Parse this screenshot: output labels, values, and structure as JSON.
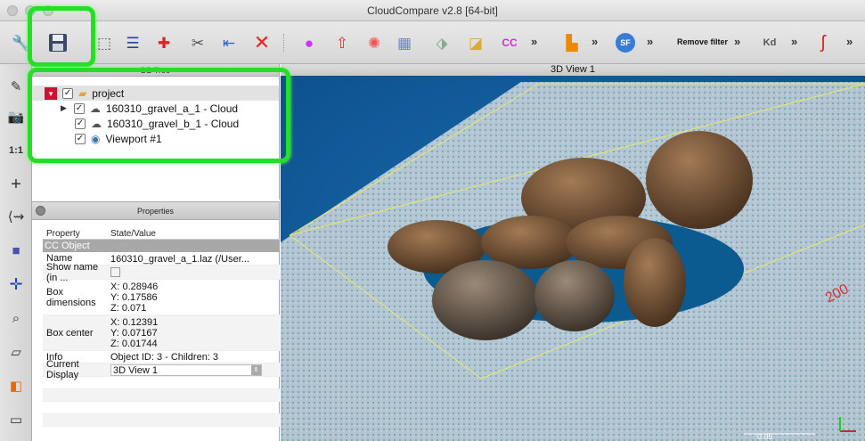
{
  "window": {
    "title": "CloudCompare v2.8 [64-bit]"
  },
  "toolbar": {
    "more": "»",
    "remove_filter_label": "Remove filter",
    "kd_label": "Kd",
    "sf_label": "SF",
    "icons": [
      "wrench-icon",
      "save-icon",
      "cursor-icon",
      "list-icon",
      "move-icon",
      "segment-icon",
      "merge-icon",
      "delete-icon",
      "color-icon",
      "normals-icon",
      "sample-icon",
      "grid-icon",
      "cube-icon",
      "triangle-icon",
      "cc-icon",
      "histogram-icon",
      "sf-icon",
      "kd-icon",
      "pen-icon"
    ]
  },
  "db_tree": {
    "header": "DB Tree",
    "items": [
      {
        "label": "project",
        "checked": "✓",
        "expander": "▾"
      },
      {
        "label": "160310_gravel_a_1 - Cloud",
        "checked": "✓",
        "expander": "▶"
      },
      {
        "label": "160310_gravel_b_1 - Cloud",
        "checked": "✓"
      },
      {
        "label": "Viewport #1",
        "checked": "✓"
      }
    ]
  },
  "properties": {
    "header": "Properties",
    "col_property": "Property",
    "col_value": "State/Value",
    "group": "CC Object",
    "rows": {
      "name_k": "Name",
      "name_v": "160310_gravel_a_1.laz (/User...",
      "showname_k": "Show name (in ...",
      "boxdim_k": "Box dimensions",
      "boxdim_x": "X: 0.28946",
      "boxdim_y": "Y: 0.17586",
      "boxdim_z": "Z: 0.071",
      "boxcenter_k": "Box center",
      "boxcenter_x": "X: 0.12391",
      "boxcenter_y": "Y: 0.07167",
      "boxcenter_z": "Z: 0.01744",
      "info_k": "Info",
      "info_v": "Object ID: 3 - Children: 3",
      "display_k": "Current Display",
      "display_v": "3D View 1"
    }
  },
  "view": {
    "title": "3D View 1",
    "scale_label": "0.05",
    "ruler_label": "200"
  },
  "colors": {
    "highlight": "#22e022",
    "background": "#0d5a9a",
    "accent": "#cc1133"
  }
}
